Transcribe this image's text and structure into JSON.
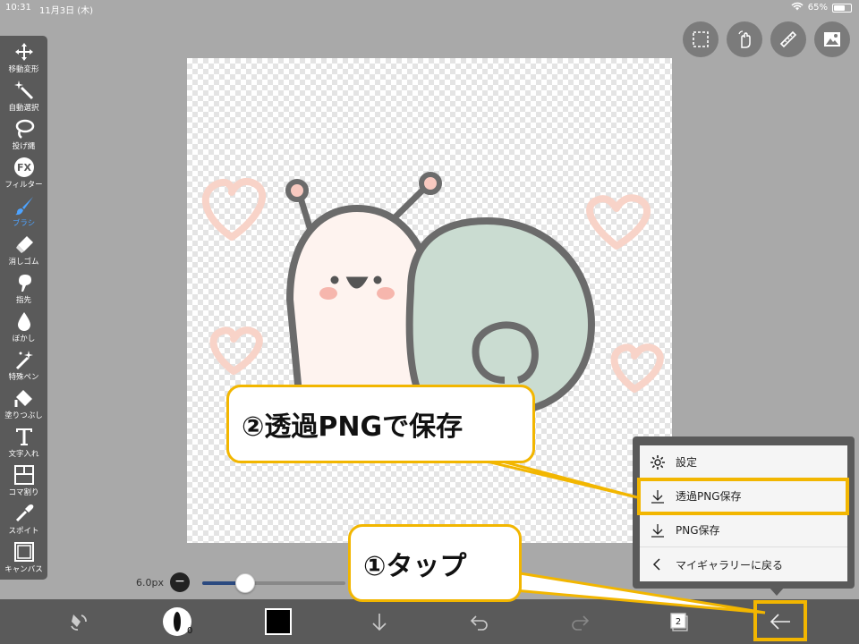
{
  "status_bar": {
    "time": "10:31",
    "date": "11月3日 (木)",
    "battery": "65%",
    "battery_level": 0.65
  },
  "toolbox": [
    {
      "label": "移動変形",
      "icon": "move-icon"
    },
    {
      "label": "自動選択",
      "icon": "magic-wand-icon"
    },
    {
      "label": "投げ縄",
      "icon": "lasso-icon"
    },
    {
      "label": "フィルター",
      "icon": "fx-filter-icon"
    },
    {
      "label": "ブラシ",
      "icon": "brush-icon"
    },
    {
      "label": "消しゴム",
      "icon": "eraser-icon"
    },
    {
      "label": "指先",
      "icon": "finger-smudge-icon"
    },
    {
      "label": "ぼかし",
      "icon": "blur-drop-icon"
    },
    {
      "label": "特殊ペン",
      "icon": "special-pen-icon"
    },
    {
      "label": "塗りつぶし",
      "icon": "fill-bucket-icon"
    },
    {
      "label": "文字入れ",
      "icon": "text-icon"
    },
    {
      "label": "コマ割り",
      "icon": "panel-divide-icon"
    },
    {
      "label": "スポイト",
      "icon": "eyedropper-icon"
    },
    {
      "label": "キャンバス",
      "icon": "canvas-icon"
    }
  ],
  "active_tool": "ブラシ",
  "top_buttons": [
    "selection-icon",
    "hand-gesture-icon",
    "ruler-icon",
    "image-icon"
  ],
  "brush": {
    "size_label": "6.0px",
    "slider_fraction": 0.3,
    "minus_symbol": "−",
    "opacity_label": "0"
  },
  "bottom_bar": {
    "layers_count": "2",
    "color": "#000000"
  },
  "menu": {
    "items": [
      {
        "label": "設定",
        "icon": "gear-icon"
      },
      {
        "label": "透過PNG保存",
        "icon": "download-icon"
      },
      {
        "label": "PNG保存",
        "icon": "download-icon"
      },
      {
        "label": "マイギャラリーに戻る",
        "icon": "chevron-left-icon"
      }
    ]
  },
  "callouts": {
    "step2": "②透過PNGで保存",
    "step1": "①タップ"
  },
  "colors": {
    "accent": "#f2b600",
    "brush_active": "#4da3ff",
    "slider": "#2b4a80",
    "toolbar": "#5a5a5a"
  }
}
